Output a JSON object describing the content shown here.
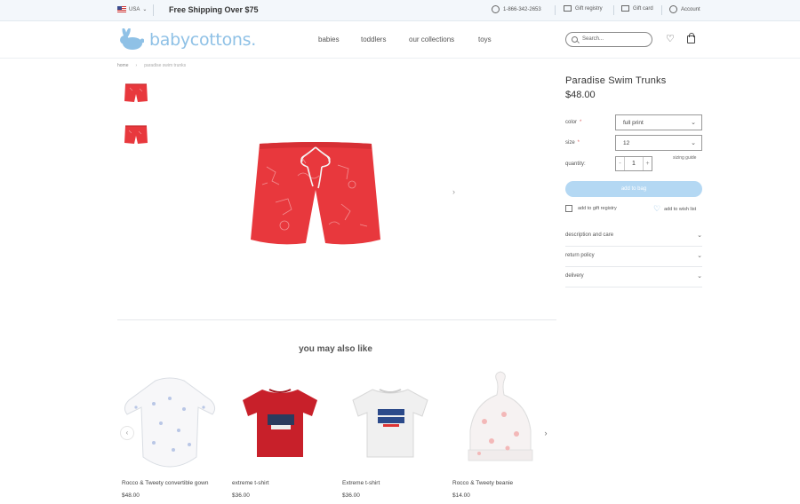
{
  "topbar": {
    "country": "USA",
    "shipping": "Free Shipping Over $75",
    "phone": "1-866-342-2653",
    "gift_registry": "Gift registry",
    "gift_card": "Gift card",
    "account": "Account"
  },
  "header": {
    "logo": "babycottons.",
    "nav": [
      "babies",
      "toddlers",
      "our collections",
      "toys"
    ],
    "search_placeholder": "Search..."
  },
  "breadcrumb": {
    "home": "home",
    "current": "paradise swim trunks"
  },
  "product": {
    "title": "Paradise Swim Trunks",
    "price": "$48.00",
    "color_label": "color",
    "color_value": "full print",
    "size_label": "size",
    "size_value": "12",
    "quantity_label": "quantity:",
    "quantity_value": "1",
    "qty_minus": "-",
    "qty_plus": "+",
    "sizing_guide": "sizing guide",
    "add_to_bag": "add to bag",
    "add_to_registry": "add to gift registry",
    "add_to_wishlist": "add to wish list",
    "accordions": [
      "description and care",
      "return policy",
      "delivery"
    ]
  },
  "recommendations": {
    "title": "you may also like",
    "items": [
      {
        "name": "Rocco & Tweety convertible gown",
        "price": "$48.00"
      },
      {
        "name": "extreme t-shirt",
        "price": "$36.00"
      },
      {
        "name": "Extreme t-shirt",
        "price": "$36.00"
      },
      {
        "name": "Rocco & Tweety beanie",
        "price": "$14.00"
      }
    ]
  },
  "colors": {
    "accent": "#8fc1e6",
    "button": "#b4d8f3",
    "product_red": "#e8383d"
  }
}
